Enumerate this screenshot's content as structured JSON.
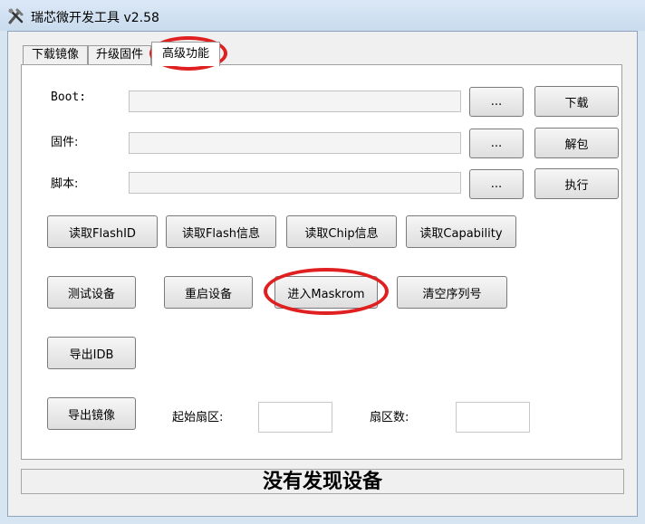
{
  "window": {
    "title": "瑞芯微开发工具 v2.58"
  },
  "tabs": [
    {
      "label": "下载镜像",
      "active": false
    },
    {
      "label": "升级固件",
      "active": false
    },
    {
      "label": "高级功能",
      "active": true
    }
  ],
  "advanced": {
    "boot": {
      "label": "Boot:",
      "value": "",
      "browse": "...",
      "action": "下载"
    },
    "firmware": {
      "label": "固件:",
      "value": "",
      "browse": "...",
      "action": "解包"
    },
    "script": {
      "label": "脚本:",
      "value": "",
      "browse": "...",
      "action": "执行"
    },
    "read_buttons": [
      "读取FlashID",
      "读取Flash信息",
      "读取Chip信息",
      "读取Capability"
    ],
    "device_buttons": [
      "测试设备",
      "重启设备",
      "进入Maskrom",
      "清空序列号"
    ],
    "export_idb": "导出IDB",
    "export_image": "导出镜像",
    "start_sector_label": "起始扇区:",
    "start_sector_value": "",
    "sector_count_label": "扇区数:",
    "sector_count_value": ""
  },
  "status": "没有发现设备",
  "colors": {
    "annotation_circle": "#e02020",
    "title_gradient": "#dbe8f6"
  }
}
